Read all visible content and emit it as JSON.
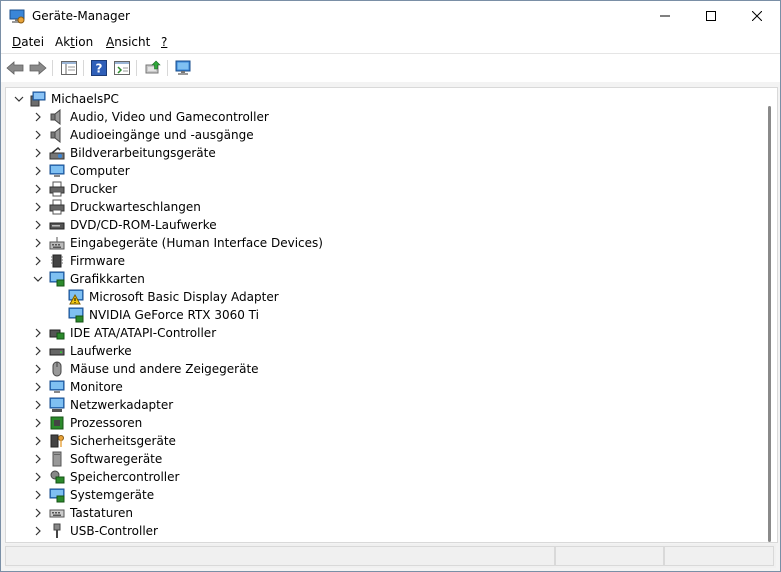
{
  "window": {
    "title": "Geräte-Manager"
  },
  "menu": [
    {
      "accel": "D",
      "rest": "atei"
    },
    {
      "pre": "Ak",
      "accel": "t",
      "rest": "ion"
    },
    {
      "accel": "A",
      "rest": "nsicht"
    },
    {
      "accel": "?",
      "rest": ""
    }
  ],
  "tree": {
    "root": "MichaelsPC",
    "categories": [
      "Audio, Video und Gamecontroller",
      "Audioeingänge und -ausgänge",
      "Bildverarbeitungsgeräte",
      "Computer",
      "Drucker",
      "Druckwarteschlangen",
      "DVD/CD-ROM-Laufwerke",
      "Eingabegeräte (Human Interface Devices)",
      "Firmware",
      "Grafikkarten",
      "Microsoft Basic Display Adapter",
      "NVIDIA GeForce RTX 3060 Ti",
      "IDE ATA/ATAPI-Controller",
      "Laufwerke",
      "Mäuse und andere Zeigegeräte",
      "Monitore",
      "Netzwerkadapter",
      "Prozessoren",
      "Sicherheitsgeräte",
      "Softwaregeräte",
      "Speichercontroller",
      "Systemgeräte",
      "Tastaturen",
      "USB-Controller"
    ]
  },
  "icons": {
    "audio": "speaker-icon",
    "monitor": "monitor-icon",
    "printer": "printer-icon",
    "gpu": "display-adapter-icon",
    "warning": "warning-icon"
  },
  "colors": {
    "accent": "#0078d4",
    "warning": "#f2c811"
  }
}
